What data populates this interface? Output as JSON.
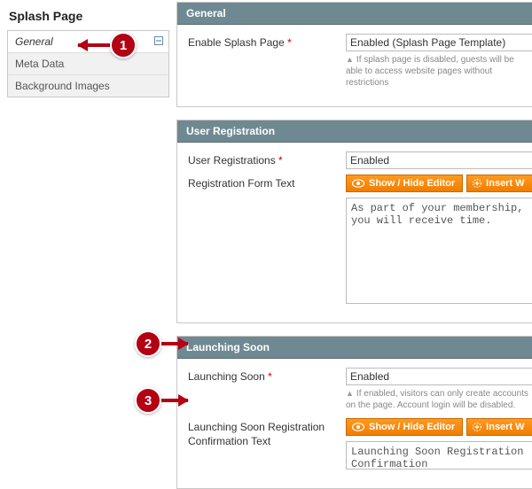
{
  "sidebar": {
    "title": "Splash Page",
    "items": [
      {
        "label": "General"
      },
      {
        "label": "Meta Data"
      },
      {
        "label": "Background Images"
      }
    ]
  },
  "sections": {
    "general": {
      "title": "General",
      "enable_label": "Enable Splash Page",
      "enable_value": "Enabled (Splash Page Template)",
      "enable_hint": "If splash page is disabled, guests will be able to access website pages without restrictions"
    },
    "user_reg": {
      "title": "User Registration",
      "reg_label": "User Registrations",
      "reg_value": "Enabled",
      "formtext_label": "Registration Form Text",
      "btn_show": "Show / Hide Editor",
      "btn_insert": "Insert W",
      "formtext_value": "As part of your membership, you will receive time."
    },
    "launch": {
      "title": "Launching Soon",
      "soon_label": "Launching Soon",
      "soon_value": "Enabled",
      "soon_hint": "If enabled, visitors can only create accounts on the page. Account login will be disabled.",
      "conf_label": "Launching Soon Registration Confirmation Text",
      "btn_show": "Show / Hide Editor",
      "btn_insert": "Insert W",
      "conf_value": "Launching Soon Registration Confirmation"
    }
  },
  "callouts": {
    "c1": "1",
    "c2": "2",
    "c3": "3"
  }
}
